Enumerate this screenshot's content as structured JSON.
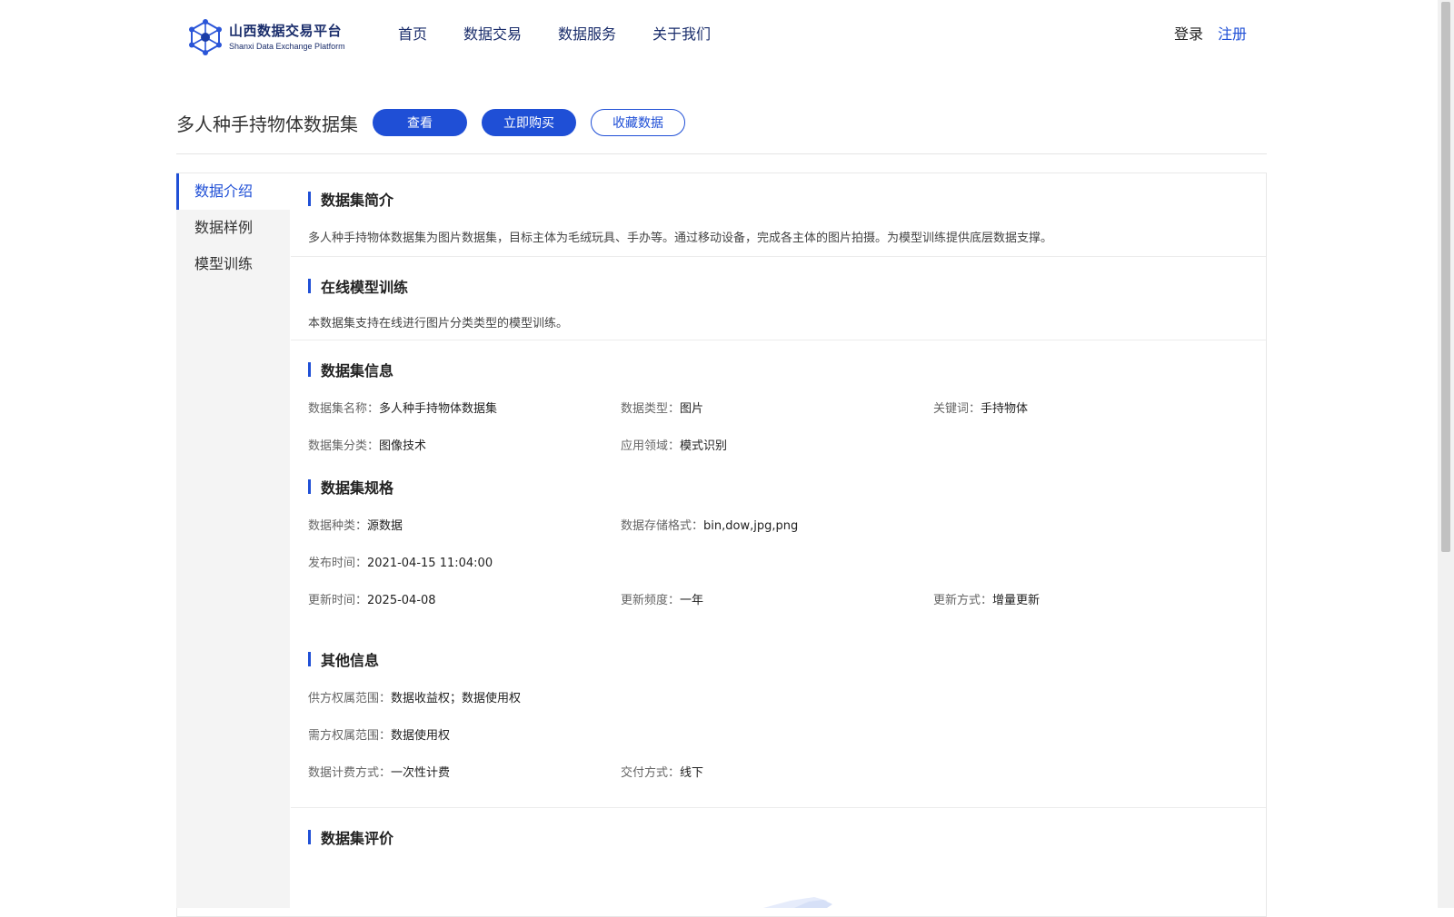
{
  "header": {
    "logo_cn": "山西数据交易平台",
    "logo_en": "Shanxi Data Exchange Platform",
    "nav": [
      "首页",
      "数据交易",
      "数据服务",
      "关于我们"
    ],
    "login": "登录",
    "register": "注册"
  },
  "title_row": {
    "title": "多人种手持物体数据集",
    "view": "查看",
    "buy": "立即购买",
    "favorite": "收藏数据"
  },
  "sidebar": {
    "items": [
      "数据介绍",
      "数据样例",
      "模型训练"
    ],
    "active_index": 0
  },
  "intro": {
    "title": "数据集简介",
    "text": "多人种手持物体数据集为图片数据集，目标主体为毛绒玩具、手办等。通过移动设备，完成各主体的图片拍摄。为模型训练提供底层数据支撑。"
  },
  "online_training": {
    "title": "在线模型训练",
    "text": "本数据集支持在线进行图片分类类型的模型训练。"
  },
  "info": {
    "title": "数据集信息",
    "name_k": "数据集名称：",
    "name_v": "多人种手持物体数据集",
    "type_k": "数据类型：",
    "type_v": "图片",
    "kw_k": "关键词：",
    "kw_v": "手持物体",
    "cat_k": "数据集分类：",
    "cat_v": "图像技术",
    "field_k": "应用领域：",
    "field_v": "模式识别"
  },
  "spec": {
    "title": "数据集规格",
    "kind_k": "数据种类：",
    "kind_v": "源数据",
    "fmt_k": "数据存储格式：",
    "fmt_v": "bin,dow,jpg,png",
    "pub_k": "发布时间：",
    "pub_v": "2021-04-15 11:04:00",
    "upd_k": "更新时间：",
    "upd_v": "2025-04-08",
    "freq_k": "更新频度：",
    "freq_v": "一年",
    "mode_k": "更新方式：",
    "mode_v": "增量更新"
  },
  "other": {
    "title": "其他信息",
    "supply_k": "供方权属范围：",
    "supply_v": "数据收益权；数据使用权",
    "demand_k": "需方权属范围：",
    "demand_v": "数据使用权",
    "billing_k": "数据计费方式：",
    "billing_v": "一次性计费",
    "delivery_k": "交付方式：",
    "delivery_v": "线下"
  },
  "review": {
    "title": "数据集评价"
  },
  "colors": {
    "accent": "#1f4fd6",
    "brand_dark": "#1a2d6b",
    "sidebar_bg": "#f4f4f4"
  },
  "icons": {
    "logo": "hexagon-network-icon"
  }
}
